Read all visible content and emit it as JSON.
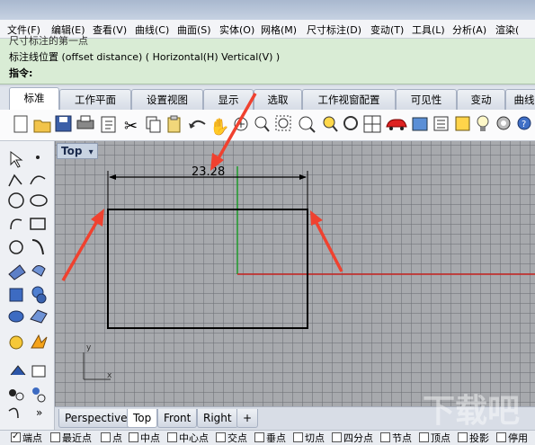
{
  "menu": [
    "文件(F)",
    "编辑(E)",
    "查看(V)",
    "曲线(C)",
    "曲面(S)",
    "实体(O)",
    "网格(M)",
    "尺寸标注(D)",
    "变动(T)",
    "工具(L)",
    "分析(A)",
    "渲染("
  ],
  "command": {
    "line1": "尺寸标注的第一点",
    "line2": "标注线位置 (offset distance) ( Horizontal(H)  Vertical(V) )",
    "prompt": "指令:"
  },
  "tabs": [
    "标准",
    "工作平面",
    "设置视图",
    "显示",
    "选取",
    "工作视窗配置",
    "可见性",
    "变动",
    "曲线"
  ],
  "active_tab": "标准",
  "viewport": {
    "name": "Top",
    "dropdown": "▾",
    "dimension_text": "23.28",
    "axis_y_label": "y",
    "axis_x_label": "x"
  },
  "viewport_tabs": [
    "Perspective",
    "Top",
    "Front",
    "Right"
  ],
  "viewport_tab_add": "+",
  "snaps": [
    {
      "label": "端点",
      "on": true
    },
    {
      "label": "最近点",
      "on": false
    },
    {
      "label": "点",
      "on": false
    },
    {
      "label": "中点",
      "on": false
    },
    {
      "label": "中心点",
      "on": false
    },
    {
      "label": "交点",
      "on": false
    },
    {
      "label": "垂点",
      "on": false
    },
    {
      "label": "切点",
      "on": false
    },
    {
      "label": "四分点",
      "on": false
    },
    {
      "label": "节点",
      "on": false
    },
    {
      "label": "顶点",
      "on": false
    },
    {
      "label": "投影",
      "on": false
    },
    {
      "label": "停用",
      "on": false
    }
  ],
  "watermark": "下载吧",
  "colors": {
    "command_bg": "#d9ecd5",
    "viewport_bg": "#a7a9ad",
    "arrow_red": "#f0412f",
    "x_axis": "#c8221e",
    "y_axis": "#1e9b2a"
  }
}
